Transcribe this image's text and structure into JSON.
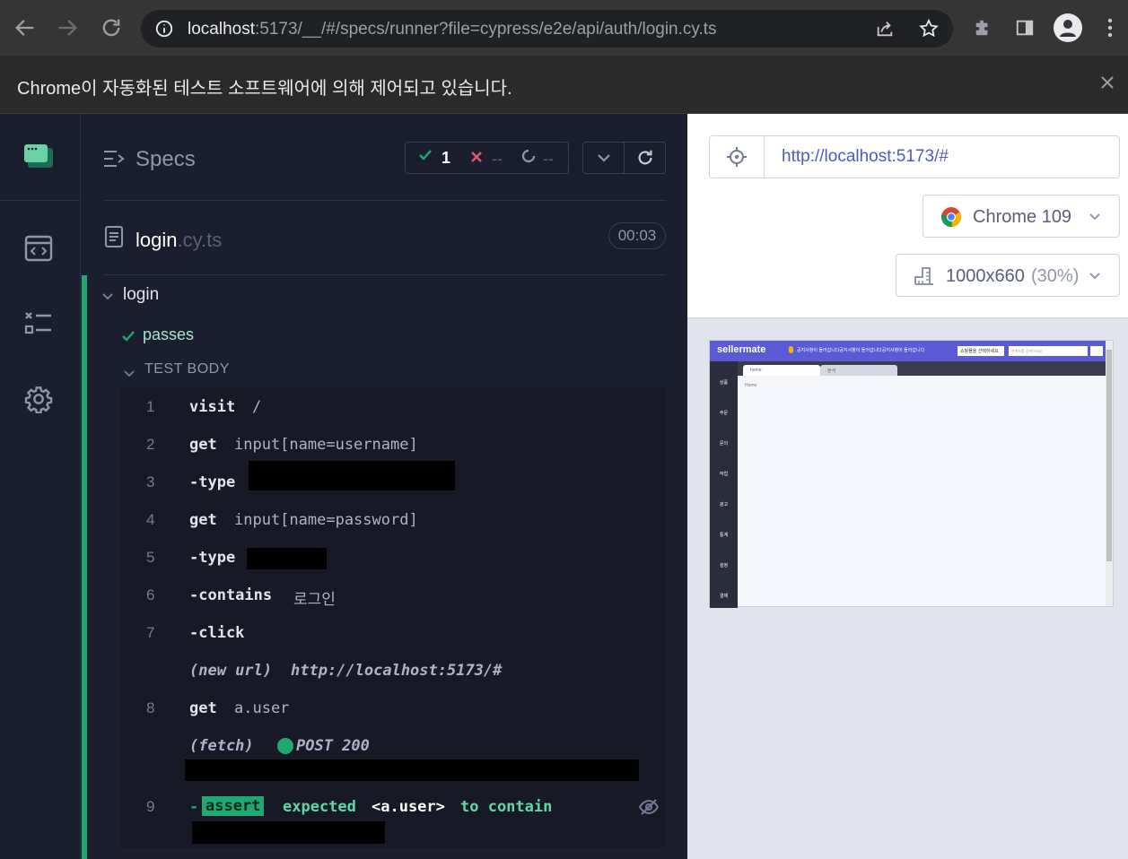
{
  "browser": {
    "url_host": "localhost",
    "url_rest": ":5173/__/#/specs/runner?file=cypress/e2e/api/auth/login.cy.ts",
    "infobar_text": "Chrome이 자동화된 테스트 소프트웨어에 의해 제어되고 있습니다.",
    "icons": [
      "back-icon",
      "forward-icon",
      "reload-icon",
      "info-icon",
      "share-icon",
      "star-icon",
      "extensions-icon",
      "sidepanel-icon",
      "profile-icon",
      "menu-icon",
      "close-icon"
    ]
  },
  "reporter": {
    "specs_label": "Specs",
    "stats": {
      "passed": "1",
      "failed": "--",
      "pending": "--"
    },
    "file_name": "login",
    "file_ext": ".cy.ts",
    "duration": "00:03",
    "suite": "login",
    "test": "passes",
    "test_body_label": "TEST BODY",
    "commands": [
      {
        "num": "1",
        "name": "visit",
        "msg": "/"
      },
      {
        "num": "2",
        "name": "get",
        "msg": "input[name=username]"
      },
      {
        "num": "3",
        "name": "-type",
        "msg": ""
      },
      {
        "num": "4",
        "name": "get",
        "msg": "input[name=password]"
      },
      {
        "num": "5",
        "name": "-type",
        "msg": ""
      },
      {
        "num": "6",
        "name": "-contains",
        "msg": "로그인"
      },
      {
        "num": "7",
        "name": "-click",
        "msg": ""
      },
      {
        "num": "",
        "name": "(new url)",
        "msg": "http://localhost:5173/#"
      },
      {
        "num": "8",
        "name": "get",
        "msg": "a.user"
      },
      {
        "num": "",
        "name": "(fetch)",
        "msg": "POST 200"
      },
      {
        "num": "9",
        "name": "assert",
        "msg": "expected <a.user> to contain"
      }
    ],
    "assert_prefix": "-",
    "assert_expected": "expected",
    "assert_subject": "<a.user>",
    "assert_to_contain": "to contain"
  },
  "aut": {
    "url": "http://localhost:5173/#",
    "browser_name": "Chrome 109",
    "viewport": "1000x660",
    "scale": "(30%)",
    "preview": {
      "brand": "sellermate",
      "notice": "공지사항이 들어갑니다공지사항이 들어갑니다공지사항이 들어갑니다",
      "select": "쇼핑몰을 선택하세요",
      "search_placeholder": "판매처를 검색하세요",
      "tabs": [
        "home",
        "분석"
      ],
      "content": "Home",
      "nav": [
        "상품",
        "주문",
        "문의",
        "작업",
        "광고",
        "통계",
        "설정",
        "결제"
      ]
    }
  }
}
